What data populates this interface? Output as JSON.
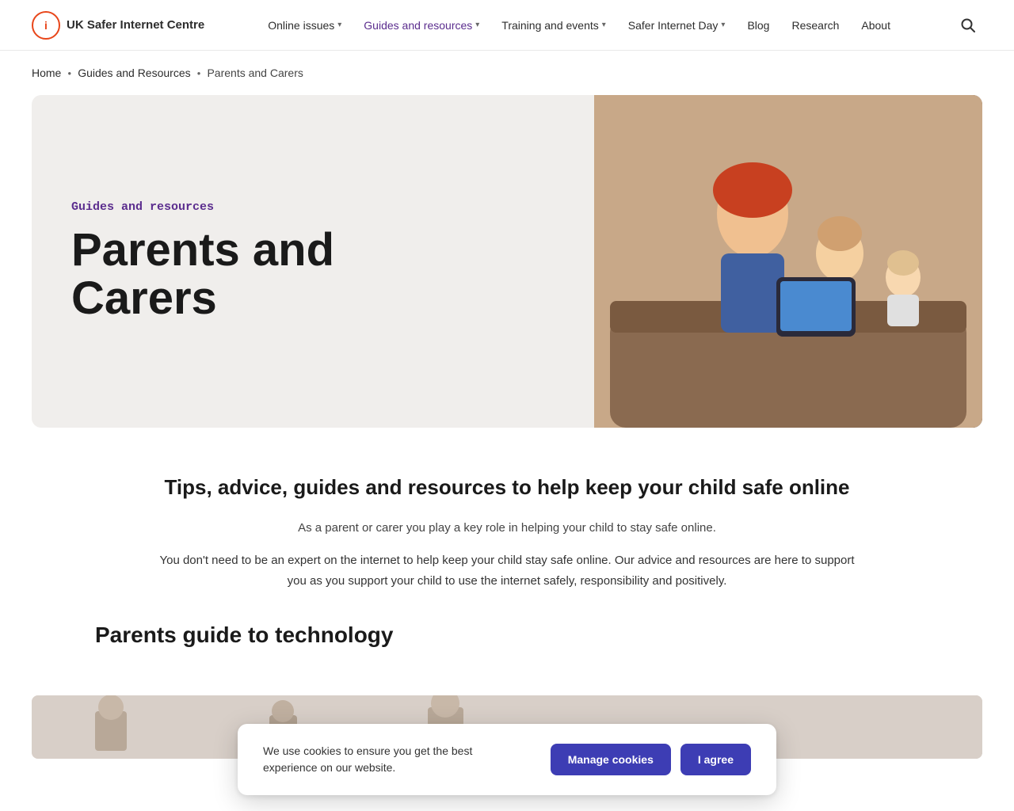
{
  "site": {
    "logo_text_line1": "UK Safer Internet Centre",
    "logo_icon_label": "uk-safer-internet-centre-logo"
  },
  "nav": {
    "items": [
      {
        "label": "Online issues",
        "has_dropdown": true,
        "active": false
      },
      {
        "label": "Guides and resources",
        "has_dropdown": true,
        "active": true
      },
      {
        "label": "Training and events",
        "has_dropdown": true,
        "active": false
      },
      {
        "label": "Safer Internet Day",
        "has_dropdown": true,
        "active": false
      },
      {
        "label": "Blog",
        "has_dropdown": false,
        "active": false
      },
      {
        "label": "Research",
        "has_dropdown": false,
        "active": false
      },
      {
        "label": "About",
        "has_dropdown": false,
        "active": false
      }
    ]
  },
  "breadcrumb": {
    "items": [
      {
        "label": "Home",
        "href": "#"
      },
      {
        "label": "Guides and Resources",
        "href": "#"
      },
      {
        "label": "Parents and Carers",
        "href": "#"
      }
    ]
  },
  "hero": {
    "category": "Guides and resources",
    "title": "Parents and\nCarers",
    "image_alt": "Parent and children looking at a tablet together"
  },
  "main": {
    "section_title": "Tips, advice, guides and resources to help keep your child safe online",
    "intro_text": "As a parent or carer you play a key role in helping your child to stay safe online.",
    "body_text": "You don't need to be an expert on the internet to help keep your child stay safe online. Our advice and resources are here to support you as you support your child to use the internet safely, responsibility and positively.",
    "guide_heading": "Parents guide to technology"
  },
  "cookie_banner": {
    "message": "We use cookies to ensure you get the best experience on our website.",
    "manage_label": "Manage cookies",
    "agree_label": "I agree"
  },
  "colors": {
    "purple": "#5b2d8e",
    "nav_blue": "#3d3db4",
    "orange": "#e8461a"
  }
}
